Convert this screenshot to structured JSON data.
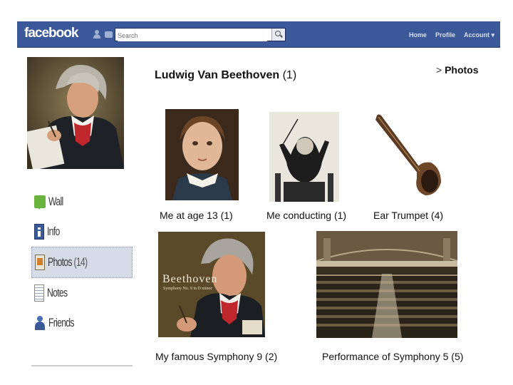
{
  "topbar": {
    "logo": "facebook",
    "search_placeholder": "Search",
    "nav": [
      "Home",
      "Profile",
      "Account ▾"
    ],
    "color": "#3b5998"
  },
  "sidebar": {
    "items": [
      {
        "label": "Wall",
        "icon": "wall-icon"
      },
      {
        "label": "Info",
        "icon": "info-icon"
      },
      {
        "label": "Photos",
        "count": "(14)",
        "icon": "photos-icon",
        "selected": true
      },
      {
        "label": "Notes",
        "icon": "notes-icon"
      },
      {
        "label": "Friends",
        "icon": "friends-icon"
      }
    ]
  },
  "header": {
    "name": "Ludwig Van Beethoven",
    "count": "(1)",
    "breadcrumb_sep": ">",
    "breadcrumb": "Photos"
  },
  "albums": [
    {
      "caption": "Me at age 13 (1)"
    },
    {
      "caption": "Me conducting (1)"
    },
    {
      "caption": "Ear Trumpet (4)"
    },
    {
      "caption": "My famous Symphony 9 (2)",
      "cover_title": "Beethoven",
      "cover_subtitle": "Symphony No. 9 in D minor"
    },
    {
      "caption": "Performance of Symphony 5 (5)"
    }
  ]
}
